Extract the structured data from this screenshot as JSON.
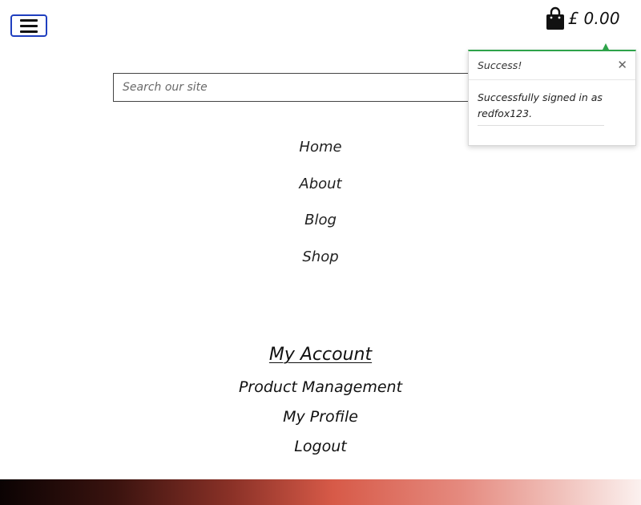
{
  "header": {
    "menu_toggle_icon": "hamburger-icon",
    "bag_icon": "shopping-bag-icon",
    "bag_total": "£ 0.00"
  },
  "search": {
    "placeholder": "Search our site",
    "value": ""
  },
  "main_nav": {
    "items": [
      {
        "label": "Home"
      },
      {
        "label": "About"
      },
      {
        "label": "Blog"
      },
      {
        "label": "Shop"
      }
    ]
  },
  "account_nav": {
    "title": "My Account",
    "items": [
      {
        "label": "Product Management"
      },
      {
        "label": "My Profile"
      },
      {
        "label": "Logout"
      }
    ]
  },
  "toast": {
    "title": "Success!",
    "message": "Successfully signed in as redfox123.",
    "close_icon": "close-icon"
  },
  "colors": {
    "menu_toggle_border": "#1f3fbf",
    "toast_accent": "#2ea34a",
    "footer_gradient_start": "#0b0303",
    "footer_gradient_mid": "#d75a48",
    "footer_gradient_end": "#fbf1ef"
  }
}
